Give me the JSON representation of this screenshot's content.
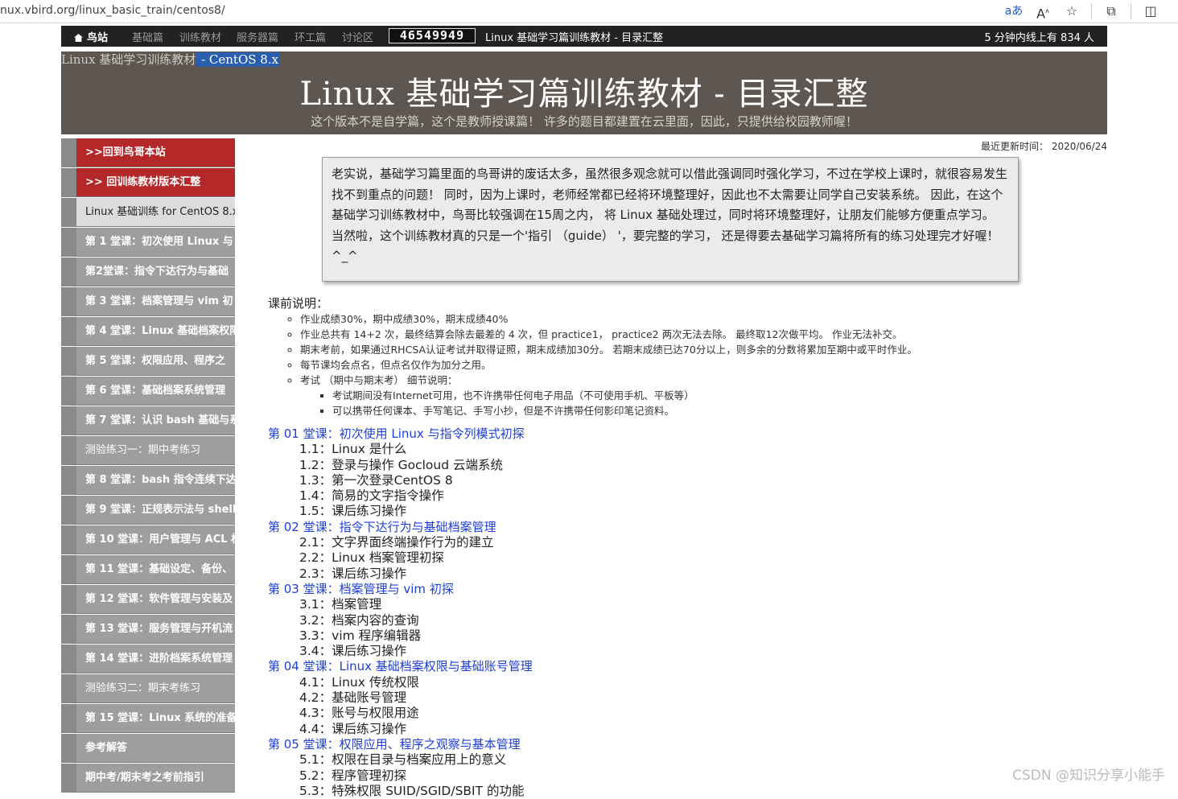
{
  "browser": {
    "url": "nux.vbird.org/linux_basic_train/centos8/",
    "icons": [
      "read-aloud-icon",
      "font-icon",
      "favorite-star-icon",
      "extensions-icon",
      "split-screen-icon"
    ]
  },
  "topnav": {
    "home": "鸟站",
    "items": [
      "基础篇",
      "训练教材",
      "服务器篇",
      "环工篇",
      "讨论区"
    ],
    "counter": "46549949",
    "page_title": "Linux 基础学习篇训练教材 - 目录汇整",
    "online": "5 分钟内线上有 834 人"
  },
  "banner": {
    "crumb_1": "Linux 基础学习训练教材",
    "crumb_2": " - CentOS 8.x",
    "title": "Linux 基础学习篇训练教材 - 目录汇整",
    "subtitle": "这个版本不是自学篇，这个是教师授课篇！ 许多的题目都建置在云里面，因此，只提供给校园教师喔！"
  },
  "updated": "最近更新时间： 2020/06/24",
  "sidebar": {
    "items": [
      ">>回到鸟哥本站",
      ">> 回训练教材版本汇整",
      "Linux 基础训练 for CentOS 8.x",
      "第 1 堂课：初次使用 Linux 与",
      "第2堂课：指令下达行为与基础",
      "第 3 堂课：档案管理与 vim 初",
      "第 4 堂课：Linux 基础档案权限",
      "第 5 堂课：权限应用、程序之",
      "第 6 堂课：基础档案系统管理",
      "第 7 堂课：认识 bash 基础与系",
      "测验练习一：期中考练习",
      "第 8 堂课：bash 指令连续下达",
      "第 9 堂课：正规表示法与 shell",
      "第 10 堂课：用户管理与 ACL 权",
      "第 11 堂课：基础设定、备份、",
      "第 12 堂课：软件管理与安装及",
      "第 13 堂课：服务管理与开机流",
      "第 14 堂课：进阶档案系统管理",
      "测验练习二：期末考练习",
      "第 15 堂课：Linux 系统的准备",
      "参考解答",
      "期中考/期末考之考前指引"
    ]
  },
  "note": "老实说，基础学习篇里面的鸟哥讲的废话太多，虽然很多观念就可以借此强调同时强化学习，不过在学校上课时，就很容易发生找不到重点的问题！ 同时，因为上课时，老师经常都已经将环境整理好，因此也不太需要让同学自己安装系统。 因此，在这个基础学习训练教材中，鸟哥比较强调在15周之内， 将 Linux 基础处理过，同时将环境整理好，让朋友们能够方便重点学习。 当然啦，这个训练教材真的只是一个'指引 （guide） '，要完整的学习， 还是得要去基础学习篇将所有的练习处理完才好喔！ ^_^",
  "pre": {
    "heading": "课前说明：",
    "items": [
      "作业成绩30%，期中成绩30%，期末成绩40%",
      "作业总共有 14+2 次，最终结算会除去最差的 4 次，但 practice1， practice2 两次无法去除。 最终取12次做平均。 作业无法补交。",
      "期末考前，如果通过RHCSA认证考试并取得证照，期末成绩加30分。 若期末成绩已达70分以上，则多余的分数将累加至期中或平时作业。",
      "每节课均会点名，但点名仅作为加分之用。",
      "考试 （期中与期末考） 细节说明："
    ],
    "exam_items": [
      "考试期间没有Internet可用，也不许携带任何电子用品（不可使用手机、平板等）",
      "可以携带任何课本、手写笔记、手写小抄，但是不许携带任何影印笔记资料。"
    ]
  },
  "toc": [
    {
      "title": "第 01 堂课：初次使用 Linux 与指令列模式初探",
      "subs": [
        "1.1：Linux 是什么",
        "1.2：登录与操作 Gocloud 云端系统",
        "1.3：第一次登录CentOS 8",
        "1.4：简易的文字指令操作",
        "1.5：课后练习操作"
      ]
    },
    {
      "title": "第 02 堂课：指令下达行为与基础档案管理",
      "subs": [
        "2.1：文字界面终端操作行为的建立",
        "2.2：Linux 档案管理初探",
        "2.3：课后练习操作"
      ]
    },
    {
      "title": "第 03 堂课：档案管理与 vim 初探",
      "subs": [
        "3.1：档案管理",
        "3.2：档案内容的查询",
        "3.3：vim 程序编辑器",
        "3.4：课后练习操作"
      ]
    },
    {
      "title": "第 04 堂课：Linux 基础档案权限与基础账号管理",
      "subs": [
        "4.1：Linux 传统权限",
        "4.2：基础账号管理",
        "4.3：账号与权限用途",
        "4.4：课后练习操作"
      ]
    },
    {
      "title": "第 05 堂课：权限应用、程序之观察与基本管理",
      "subs": [
        "5.1：权限在目录与档案应用上的意义",
        "5.2：程序管理初探",
        "5.3：特殊权限 SUID/SGID/SBIT 的功能"
      ]
    }
  ],
  "watermark": "CSDN @知识分享小能手"
}
